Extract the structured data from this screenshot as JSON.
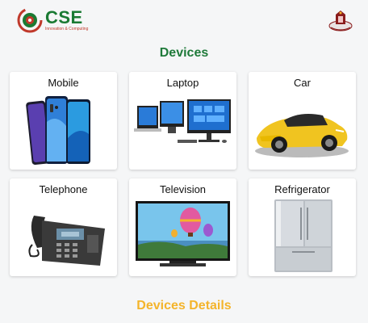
{
  "brand": {
    "name": "CSE",
    "tagline": "Innovation & Computing",
    "colors": {
      "green": "#1a7a33",
      "red": "#c0392b",
      "accent": "#f4b42b"
    }
  },
  "header": {
    "logo_icon": "cse-logo",
    "emblem_icon": "institution-emblem"
  },
  "devices_section": {
    "title": "Devices",
    "cards": [
      {
        "label": "Mobile",
        "icon": "mobile-phones-image"
      },
      {
        "label": "Laptop",
        "icon": "laptop-monitors-image"
      },
      {
        "label": "Car",
        "icon": "sports-car-image"
      },
      {
        "label": "Telephone",
        "icon": "desk-telephone-image"
      },
      {
        "label": "Television",
        "icon": "television-image"
      },
      {
        "label": "Refrigerator",
        "icon": "refrigerator-image"
      }
    ]
  },
  "details_section": {
    "title": "Devices Details"
  }
}
